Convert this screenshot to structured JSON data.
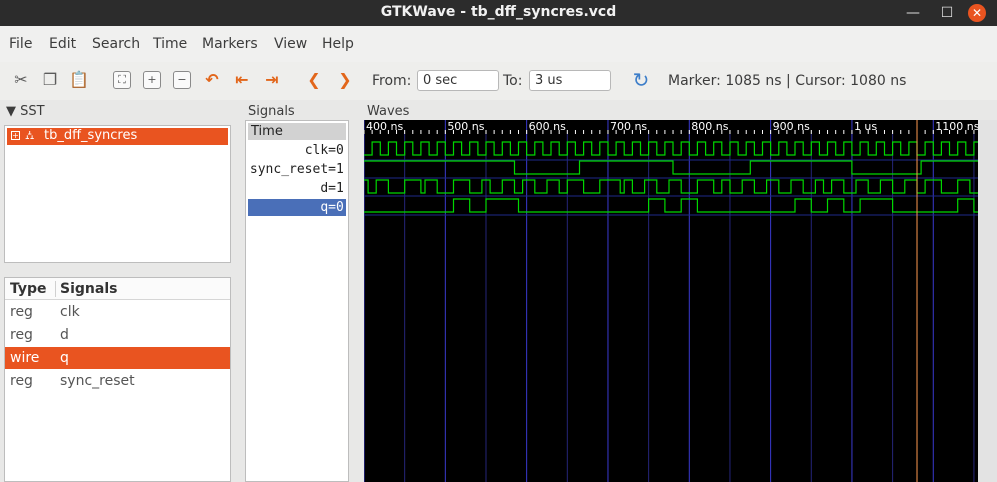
{
  "window": {
    "title": "GTKWave - tb_dff_syncres.vcd"
  },
  "menu": [
    "File",
    "Edit",
    "Search",
    "Time",
    "Markers",
    "View",
    "Help"
  ],
  "toolbar": {
    "from_label": "From:",
    "from_value": "0 sec",
    "to_label": "To:",
    "to_value": "3 us",
    "marker_text": "Marker: 1085 ns",
    "separator": "|",
    "cursor_text": "Cursor: 1080 ns"
  },
  "sst": {
    "header": "SST",
    "tree_item": "tb_dff_syncres",
    "columns": [
      "Type",
      "Signals"
    ],
    "rows": [
      {
        "type": "reg",
        "name": "clk"
      },
      {
        "type": "reg",
        "name": "d"
      },
      {
        "type": "wire",
        "name": "q"
      },
      {
        "type": "reg",
        "name": "sync_reset"
      }
    ],
    "selected_row": 2
  },
  "signals_panel": {
    "header": "Signals",
    "time_label": "Time",
    "signals": [
      {
        "name": "clk",
        "value": "0"
      },
      {
        "name": "sync_reset",
        "value": "1"
      },
      {
        "name": "d",
        "value": "1"
      },
      {
        "name": "q",
        "value": "0"
      }
    ],
    "selected_index": 3
  },
  "waves_panel": {
    "header": "Waves",
    "view_start_ns": 400,
    "view_end_ns": 1155,
    "ticks": [
      {
        "t": 400,
        "label": "400 ns"
      },
      {
        "t": 500,
        "label": "500 ns"
      },
      {
        "t": 600,
        "label": "600 ns"
      },
      {
        "t": 700,
        "label": "700 ns"
      },
      {
        "t": 800,
        "label": "800 ns"
      },
      {
        "t": 900,
        "label": "900 ns"
      },
      {
        "t": 1000,
        "label": "1 us"
      },
      {
        "t": 1100,
        "label": "1100 ns"
      }
    ],
    "cursor_ns": 1080,
    "clk_period_ns": 20,
    "traces": {
      "clk": {
        "initial": 0,
        "edges": []
      },
      "sync_reset": {
        "initial": 1,
        "edges": [
          585,
          665,
          780,
          875,
          1000,
          1085
        ]
      },
      "d": {
        "initial": 1,
        "edges": [
          405,
          415,
          430,
          450,
          470,
          475,
          490,
          510,
          530,
          545,
          555,
          570,
          585,
          595,
          610,
          625,
          640,
          650,
          670,
          690,
          715,
          720,
          730,
          745,
          760,
          775,
          790,
          810,
          830,
          840,
          850,
          865,
          880,
          895,
          910,
          925,
          940,
          955,
          965,
          975,
          990,
          1005,
          1020,
          1035,
          1050,
          1065,
          1080,
          1090,
          1110,
          1130,
          1145
        ]
      },
      "q": {
        "initial": 0,
        "edges": [
          510,
          530,
          550,
          590,
          750,
          770,
          790,
          810,
          930,
          950,
          970,
          990,
          1010,
          1050,
          1130,
          1150
        ]
      }
    },
    "colors": {
      "background": "#000000",
      "trace": "#00d800",
      "grid_major": "#3a3ad0",
      "grid_minor": "#25257a",
      "cursor": "#ff9a50",
      "ruler_text": "#ffffff"
    }
  },
  "colors": {
    "accent": "#e95420",
    "selection_blue": "#4a6fb8",
    "titlebar": "#2c2c2c"
  }
}
